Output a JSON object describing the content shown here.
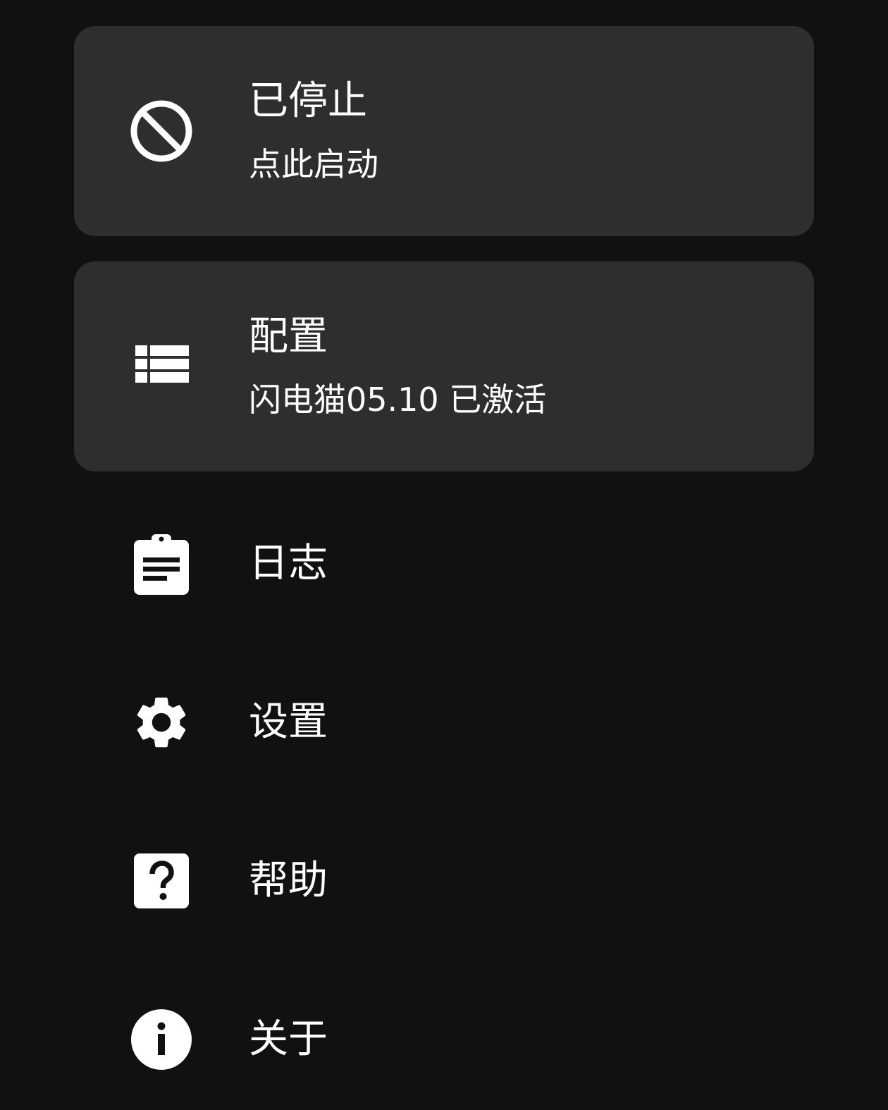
{
  "status_card": {
    "title": "已停止",
    "subtitle": "点此启动",
    "icon": "block-icon"
  },
  "profile_card": {
    "title": "配置",
    "subtitle": "闪电猫05.10 已激活",
    "icon": "list-icon"
  },
  "menu": {
    "logs": {
      "label": "日志",
      "icon": "clipboard-icon"
    },
    "settings": {
      "label": "设置",
      "icon": "gear-icon"
    },
    "help": {
      "label": "帮助",
      "icon": "help-icon"
    },
    "about": {
      "label": "关于",
      "icon": "info-icon"
    }
  },
  "colors": {
    "background": "#111111",
    "card": "#2e2e2e",
    "text": "#ffffff"
  }
}
